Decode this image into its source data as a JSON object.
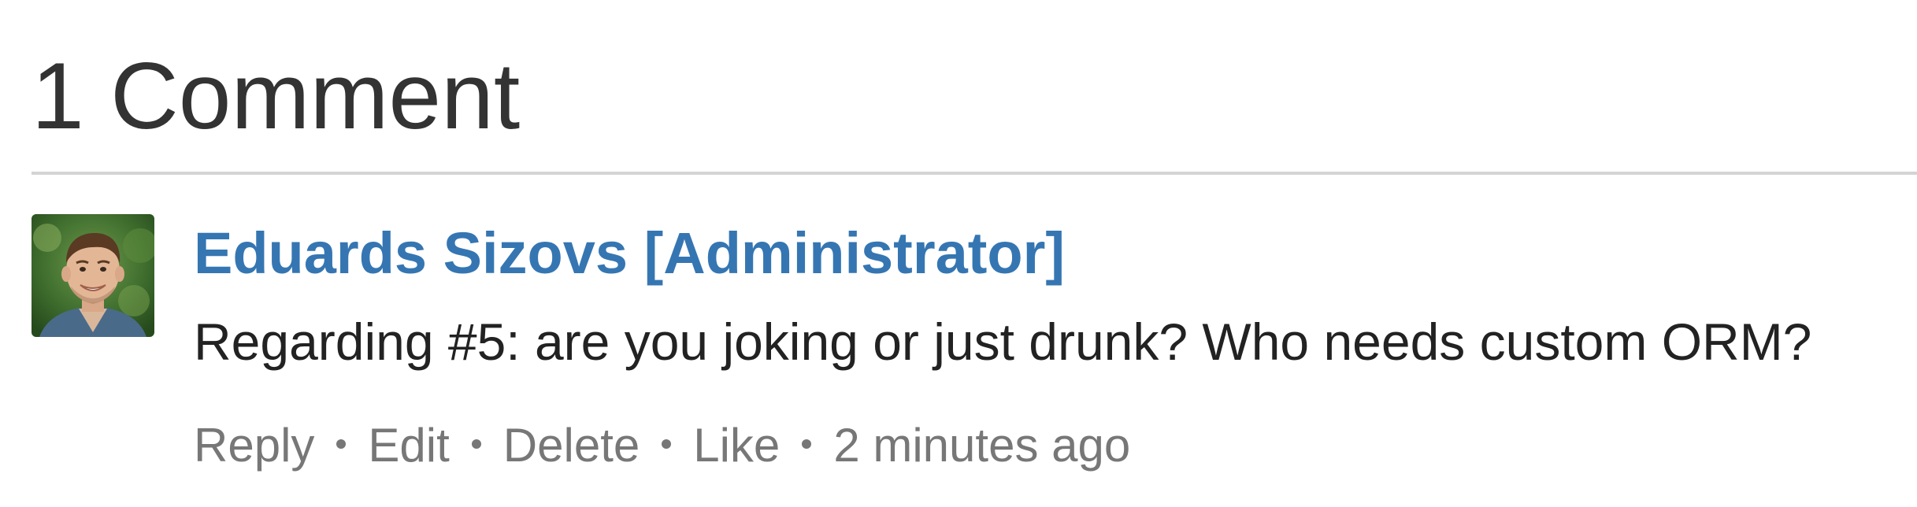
{
  "comments_section": {
    "heading": "1 Comment",
    "comments": [
      {
        "author": "Eduards Sizovs [Administrator]",
        "text": "Regarding #5: are you joking or just drunk? Who needs custom ORM?",
        "actions": {
          "reply": "Reply",
          "edit": "Edit",
          "delete": "Delete",
          "like": "Like"
        },
        "timestamp": "2 minutes ago",
        "avatar_icon": "user-photo"
      }
    ]
  },
  "colors": {
    "author_link": "#3576b2",
    "heading_text": "#333333",
    "body_text": "#222222",
    "meta_text": "#777777",
    "divider": "#d4d4d4"
  }
}
